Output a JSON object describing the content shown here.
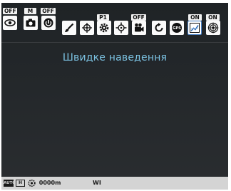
{
  "menu": {
    "tags": [
      "OFF",
      "M",
      "OFF",
      "P1",
      "OFF",
      "ON",
      "ON"
    ],
    "icons": [
      "eye-icon",
      "camera-icon",
      "power-save-icon",
      "brush-icon",
      "crosshair-icon",
      "gear-icon",
      "crosshair-dots-icon",
      "video-camera-icon",
      "refresh-icon",
      "gps-icon",
      "chart-icon",
      "target-icon"
    ],
    "selected_icon": "chart-icon"
  },
  "title": "Швидке наведення",
  "status": {
    "mode": "AUTO",
    "slot": "H",
    "distance": "0000m",
    "wifi": "WI"
  },
  "colors": {
    "screen_bg": "#23272a",
    "title": "#7cc3e3",
    "selection": "#4c84c8",
    "status_bar": "#d4d4d4"
  }
}
